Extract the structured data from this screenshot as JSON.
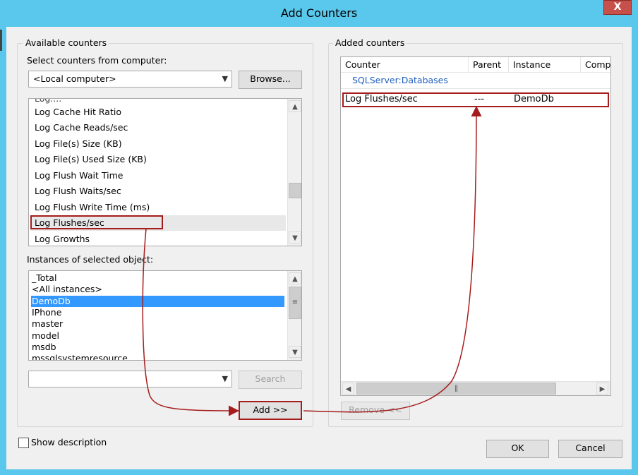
{
  "window": {
    "title": "Add Counters",
    "close_label": "X"
  },
  "available": {
    "group_title": "Available counters",
    "select_label": "Select counters from computer:",
    "computer_value": "<Local computer>",
    "browse_label": "Browse...",
    "counters": [
      "Log Cache Hit Ratio",
      "Log Cache Reads/sec",
      "Log File(s) Size (KB)",
      "Log File(s) Used Size (KB)",
      "Log Flush Wait Time",
      "Log Flush Waits/sec",
      "Log Flush Write Time (ms)",
      "Log Flushes/sec",
      "Log Growths"
    ],
    "selected_counter": "Log Flushes/sec",
    "instances_label": "Instances of selected object:",
    "instances": [
      "_Total",
      "<All instances>",
      "DemoDb",
      "IPhone",
      "master",
      "model",
      "msdb",
      "mssqlsystemresource"
    ],
    "selected_instance": "DemoDb",
    "search_value": "",
    "search_label": "Search",
    "add_label": "Add >>"
  },
  "added": {
    "group_title": "Added counters",
    "columns": [
      "Counter",
      "Parent",
      "Instance",
      "Comp"
    ],
    "object_name": "SQLServer:Databases",
    "rows": [
      {
        "counter": "Log Flushes/sec",
        "parent": "---",
        "instance": "DemoDb"
      }
    ],
    "remove_label": "Remove <<"
  },
  "footer": {
    "show_description_label": "Show description",
    "show_description_checked": false,
    "ok_label": "OK",
    "cancel_label": "Cancel"
  },
  "colors": {
    "titlebar": "#5ac8ec",
    "selection": "#3399ff",
    "highlight_annotation": "#a51c1c",
    "object_name_text": "#1f5fbf"
  }
}
